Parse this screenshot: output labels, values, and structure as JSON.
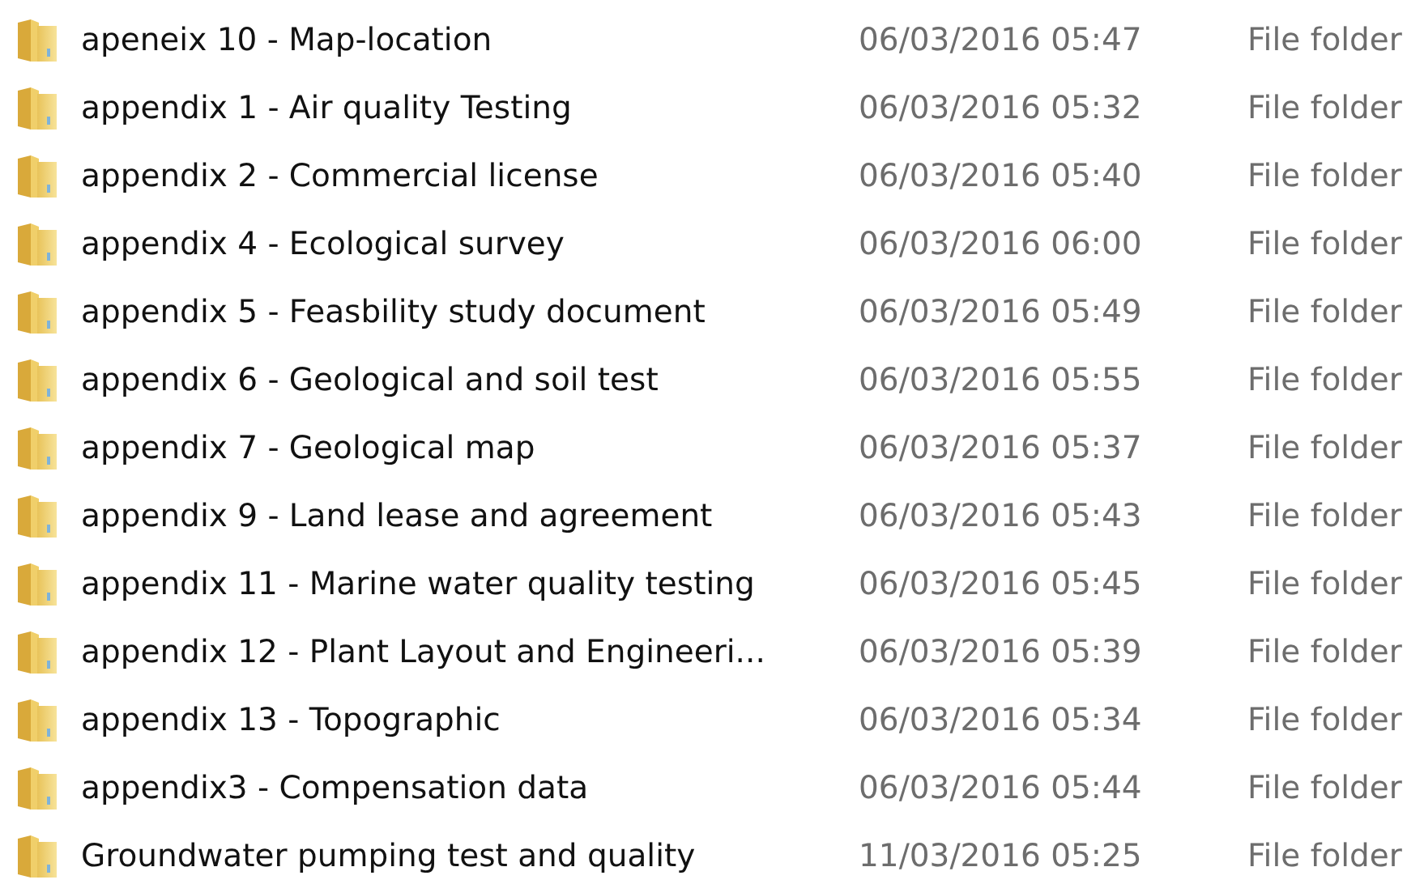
{
  "files": [
    {
      "name": "apeneix 10 - Map-location",
      "date": "06/03/2016 05:47",
      "type": "File folder"
    },
    {
      "name": "appendix 1 - Air quality Testing",
      "date": "06/03/2016 05:32",
      "type": "File folder"
    },
    {
      "name": "appendix 2 - Commercial license",
      "date": "06/03/2016 05:40",
      "type": "File folder"
    },
    {
      "name": "appendix 4 - Ecological survey",
      "date": "06/03/2016 06:00",
      "type": "File folder"
    },
    {
      "name": "appendix 5 - Feasbility study document",
      "date": "06/03/2016 05:49",
      "type": "File folder"
    },
    {
      "name": "appendix 6 - Geological and soil test",
      "date": "06/03/2016 05:55",
      "type": "File folder"
    },
    {
      "name": "appendix 7 - Geological map",
      "date": "06/03/2016 05:37",
      "type": "File folder"
    },
    {
      "name": "appendix 9 - Land lease and agreement",
      "date": "06/03/2016 05:43",
      "type": "File folder"
    },
    {
      "name": "appendix 11 - Marine water quality testing",
      "date": "06/03/2016 05:45",
      "type": "File folder"
    },
    {
      "name": "appendix 12 - Plant Layout and Engineeri...",
      "date": "06/03/2016 05:39",
      "type": "File folder"
    },
    {
      "name": "appendix 13 - Topographic",
      "date": "06/03/2016 05:34",
      "type": "File folder"
    },
    {
      "name": "appendix3 - Compensation data",
      "date": "06/03/2016 05:44",
      "type": "File folder"
    },
    {
      "name": "Groundwater pumping test and quality",
      "date": "11/03/2016 05:25",
      "type": "File folder"
    }
  ]
}
